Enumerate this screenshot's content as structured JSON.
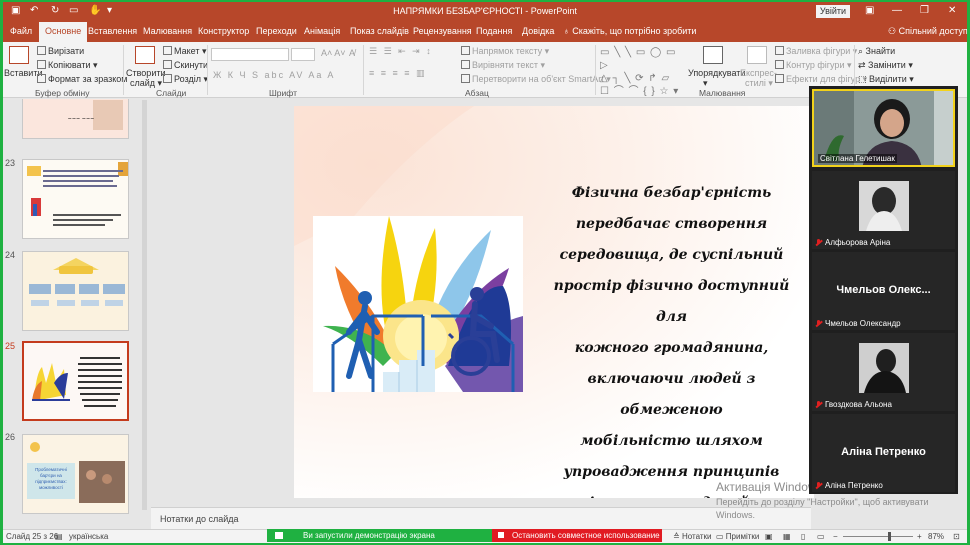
{
  "titlebar": {
    "title": "НАПРЯМКИ БЕЗБАР'ЄРНОСТІ  -  PowerPoint",
    "signin": "Увійти"
  },
  "tabs": [
    {
      "label": "Файл"
    },
    {
      "label": "Основне"
    },
    {
      "label": "Вставлення"
    },
    {
      "label": "Малювання"
    },
    {
      "label": "Конструктор"
    },
    {
      "label": "Переходи"
    },
    {
      "label": "Анімація"
    },
    {
      "label": "Показ слайдів"
    },
    {
      "label": "Рецензування"
    },
    {
      "label": "Подання"
    },
    {
      "label": "Довідка"
    }
  ],
  "tellme": "Скажіть, що потрібно зробити",
  "share": "Спільний доступ",
  "ribbon": {
    "paste": "Вставити",
    "cut": "Вирізати",
    "copy": "Копіювати",
    "format_painter": "Формат за зразком",
    "clipboard_group": "Буфер обміну",
    "new_slide_1": "Створити",
    "new_slide_2": "слайд",
    "layout": "Макет",
    "reset": "Скинути",
    "section": "Розділ",
    "slides_group": "Слайди",
    "font_group": "Шрифт",
    "text_direction": "Напрямок тексту",
    "align_text": "Вирівняти текст",
    "smartart": "Перетворити на об'єкт SmartArt",
    "paragraph_group": "Абзац",
    "arrange": "Упорядкувати",
    "quick_styles_1": "Експрес-",
    "quick_styles_2": "стилі",
    "shape_fill": "Заливка фігури",
    "shape_outline": "Контур фігури",
    "shape_effects": "Ефекти для фігур",
    "drawing_group": "Малювання",
    "find": "Знайти",
    "replace": "Замінити",
    "select": "Виділити"
  },
  "thumbnails": [
    {
      "num": "23"
    },
    {
      "num": "24"
    },
    {
      "num": "25"
    },
    {
      "num": "26"
    }
  ],
  "thumb_text": {
    "t26": "Проблематичні бар'єри на підприємствах: можливості"
  },
  "slide": {
    "lines": [
      "Фізична безбар'єрність",
      "передбачає створення",
      "середовища, де суспільний",
      "простір фізично доступний для",
      "кожного громадянина,",
      "включаючи людей з обмеженою",
      "мобільністю шляхом",
      "упровадження принципів",
      "універсального дизайну."
    ]
  },
  "notes_placeholder": "Нотатки до слайда",
  "activation": {
    "line1": "Активація Windows",
    "line2": "Перейдіть до розділу \"Настройки\", щоб активувати",
    "line3": "Windows."
  },
  "statusbar": {
    "slide_info": "Слайд 25 з 26",
    "language": "українська",
    "share_banner": "Ви запустили демонстрацію экрана",
    "stop_banner": "Остановить совместное использование",
    "notes": "Нотатки",
    "comments": "Примітки",
    "zoom": "87%"
  },
  "participants": [
    {
      "name": "Світлана Гелетишак",
      "muted": false,
      "video": true
    },
    {
      "name": "Алфьорова Аріна",
      "muted": true,
      "video": true
    },
    {
      "name": "Чмельов Олександр",
      "muted": true,
      "video": false,
      "big": "Чмельов  Олекс..."
    },
    {
      "name": "Гвоздкова Альона",
      "muted": true,
      "video": true
    },
    {
      "name": "Аліна Петренко",
      "muted": true,
      "video": false,
      "big": "Аліна Петренко"
    }
  ],
  "colors": {
    "powerpoint_red": "#b7472a",
    "zoom_green": "#1fb141",
    "stop_red": "#e11b22"
  }
}
